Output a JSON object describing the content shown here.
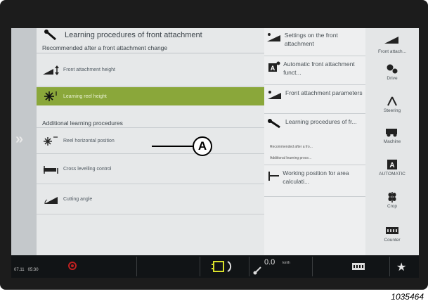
{
  "left_menu": {
    "title": "Learning procedures of front attachment",
    "subtitle": "Recommended after a front attachment change",
    "items": [
      {
        "label": "Front attachment height",
        "icon": "height-icon"
      },
      {
        "label": "Learning reel height",
        "icon": "reel-icon",
        "selected": true
      }
    ],
    "section": "Additional learning procedures",
    "additional_items": [
      {
        "label": "Reel horizontal position",
        "icon": "reel-horizontal-icon"
      },
      {
        "label": "Cross levelling control",
        "icon": "cross-level-icon"
      },
      {
        "label": "Cutting angle",
        "icon": "cutting-angle-icon"
      }
    ]
  },
  "mid_menu": {
    "items": [
      {
        "label": "Settings on the front attachment",
        "icon": "wedge-icon"
      },
      {
        "label": "Automatic front attachment funct...",
        "icon": "auto-a-icon"
      },
      {
        "label": "Front attachment parameters",
        "icon": "wedge-icon"
      },
      {
        "label": "Learning procedures of fr...",
        "icon": "wrench-icon",
        "sub1": "Recommended after a fro...",
        "sub2": "Additional learning proce..."
      },
      {
        "label": "Working position for area calculati...",
        "icon": "position-icon"
      }
    ]
  },
  "right_menu": {
    "items": [
      {
        "label": "Front attach..."
      },
      {
        "label": "Drive"
      },
      {
        "label": "Steering"
      },
      {
        "label": "Machine"
      },
      {
        "label": "AUTOMATIC"
      },
      {
        "label": "Crop"
      },
      {
        "label": "Counter"
      }
    ]
  },
  "status_bar": {
    "date": "07.11",
    "time": "05:30",
    "speed": "0.0",
    "speed_unit": "km/h"
  },
  "callout_label": "A",
  "figure_number": "1035464",
  "colors": {
    "accent": "#8aa73a",
    "bar": "#111416"
  }
}
